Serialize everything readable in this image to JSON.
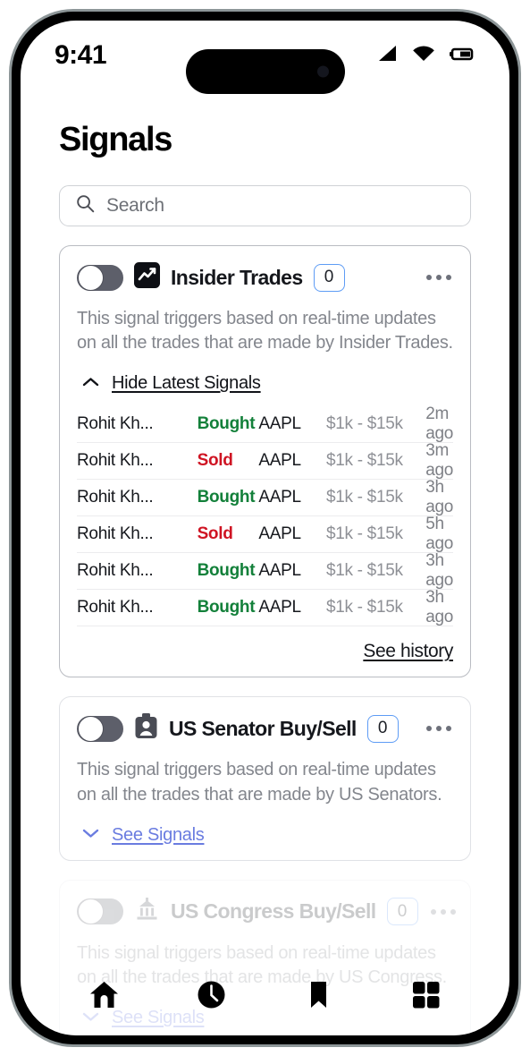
{
  "status_bar": {
    "time": "9:41",
    "icons": [
      "cellular-signal-icon",
      "wifi-icon",
      "battery-icon"
    ]
  },
  "header": {
    "title": "Signals"
  },
  "search": {
    "placeholder": "Search",
    "value": "",
    "icon": "search-icon"
  },
  "colors": {
    "accent_blue": "#5e9cf5",
    "link_blue": "#6a7ce0",
    "bought_green": "#13803a",
    "sold_red": "#cf1423",
    "toggle_track": "#5d5f6a",
    "muted_text": "#83868d"
  },
  "cards": [
    {
      "id": "insider-trades",
      "icon": "line-chart-icon",
      "title": "Insider Trades",
      "count": "0",
      "toggle_state": "off",
      "menu": "more-options-icon",
      "description": "This signal triggers based on real-time updates on all the trades that are made by Insider Trades.",
      "disclosure_label": "Hide Latest Signals",
      "disclosure_icon": "chevron-up-icon",
      "expanded": true,
      "see_history_label": "See history",
      "table": {
        "rows": [
          {
            "name": "Rohit Kh...",
            "action": "Bought",
            "ticker": "AAPL",
            "amount": "$1k - $15k",
            "time": "2m ago"
          },
          {
            "name": "Rohit Kh...",
            "action": "Sold",
            "ticker": "AAPL",
            "amount": "$1k - $15k",
            "time": "3m ago"
          },
          {
            "name": "Rohit Kh...",
            "action": "Bought",
            "ticker": "AAPL",
            "amount": "$1k - $15k",
            "time": "3h ago"
          },
          {
            "name": "Rohit Kh...",
            "action": "Sold",
            "ticker": "AAPL",
            "amount": "$1k - $15k",
            "time": "5h ago"
          },
          {
            "name": "Rohit Kh...",
            "action": "Bought",
            "ticker": "AAPL",
            "amount": "$1k - $15k",
            "time": "3h ago"
          },
          {
            "name": "Rohit Kh...",
            "action": "Bought",
            "ticker": "AAPL",
            "amount": "$1k - $15k",
            "time": "3h ago"
          }
        ]
      }
    },
    {
      "id": "us-senator-buy-sell",
      "icon": "id-badge-icon",
      "title": "US Senator Buy/Sell",
      "count": "0",
      "toggle_state": "off",
      "menu": "more-options-icon",
      "description": "This signal triggers based on real-time updates on all the trades that are made by US Senators.",
      "disclosure_label": "See Signals",
      "disclosure_icon": "chevron-down-icon",
      "expanded": false
    },
    {
      "id": "us-congress-buy-sell",
      "icon": "capitol-building-icon",
      "title": "US Congress Buy/Sell",
      "count": "0",
      "toggle_state": "off",
      "menu": "more-options-icon",
      "description": "This signal triggers based on real-time updates on all the trades that are made by US Congress.",
      "disclosure_label": "See Signals",
      "disclosure_icon": "chevron-down-icon",
      "expanded": false
    }
  ],
  "bottom_nav": {
    "items": [
      {
        "id": "home",
        "icon": "home-icon"
      },
      {
        "id": "history",
        "icon": "clock-icon"
      },
      {
        "id": "saved",
        "icon": "bookmark-icon"
      },
      {
        "id": "more",
        "icon": "grid-icon"
      }
    ]
  }
}
